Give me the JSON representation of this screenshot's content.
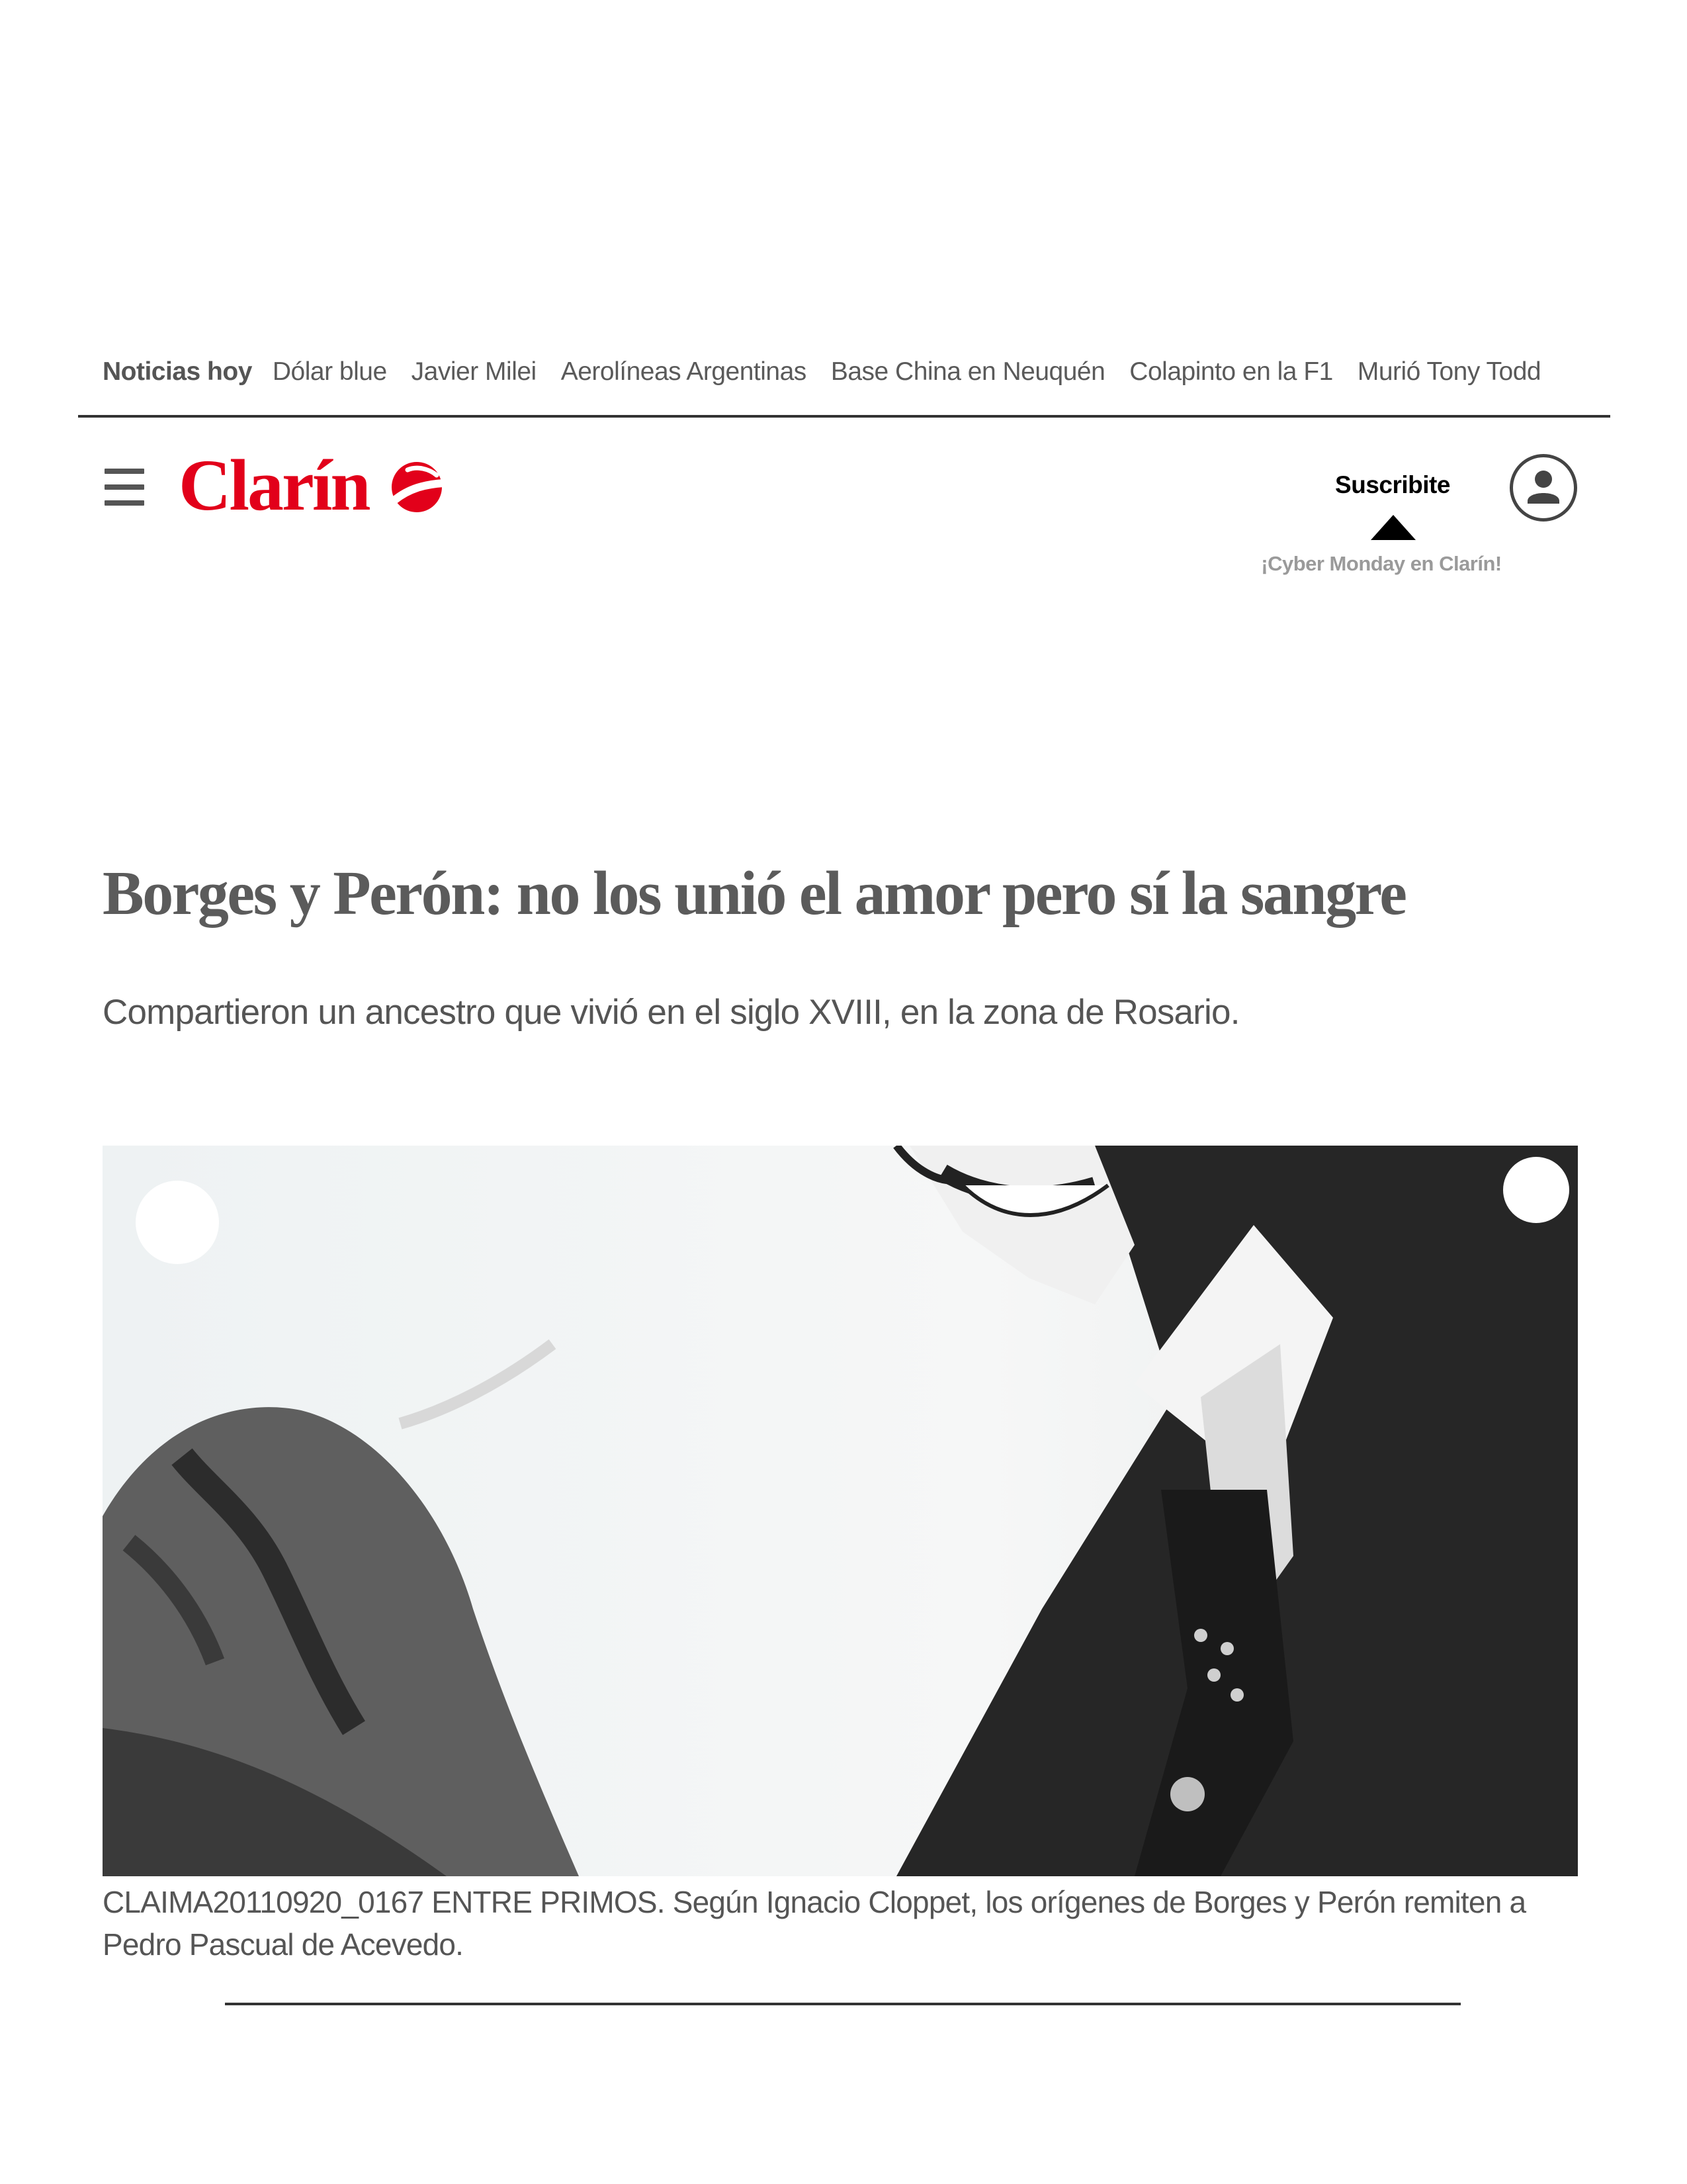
{
  "trending": {
    "label": "Noticias hoy",
    "tags": [
      "Dólar blue",
      "Javier Milei",
      "Aerolíneas Argentinas",
      "Base China en Neuquén",
      "Colapinto en la F1",
      "Murió Tony Todd"
    ]
  },
  "header": {
    "logo_text": "Clarín",
    "subscribe_label": "Suscribite",
    "promo_text": "¡Cyber Monday en Clarín!",
    "icons": {
      "menu": "hamburger-menu-icon",
      "account": "user-account-icon"
    }
  },
  "article": {
    "headline": "Borges y Perón: no los unió el amor pero sí la sangre",
    "subhead": "Compartieron un ancestro que vivió en el siglo XVIII, en la zona de Rosario.",
    "caption": "CLAIMA20110920_0167 ENTRE PRIMOS. Según Ignacio Cloppet, los orígenes de Borges y Perón remiten a Pedro Pascual de Acevedo."
  },
  "colors": {
    "brand_red": "#e2001a",
    "text_gray": "#555555",
    "rule": "#333333"
  }
}
